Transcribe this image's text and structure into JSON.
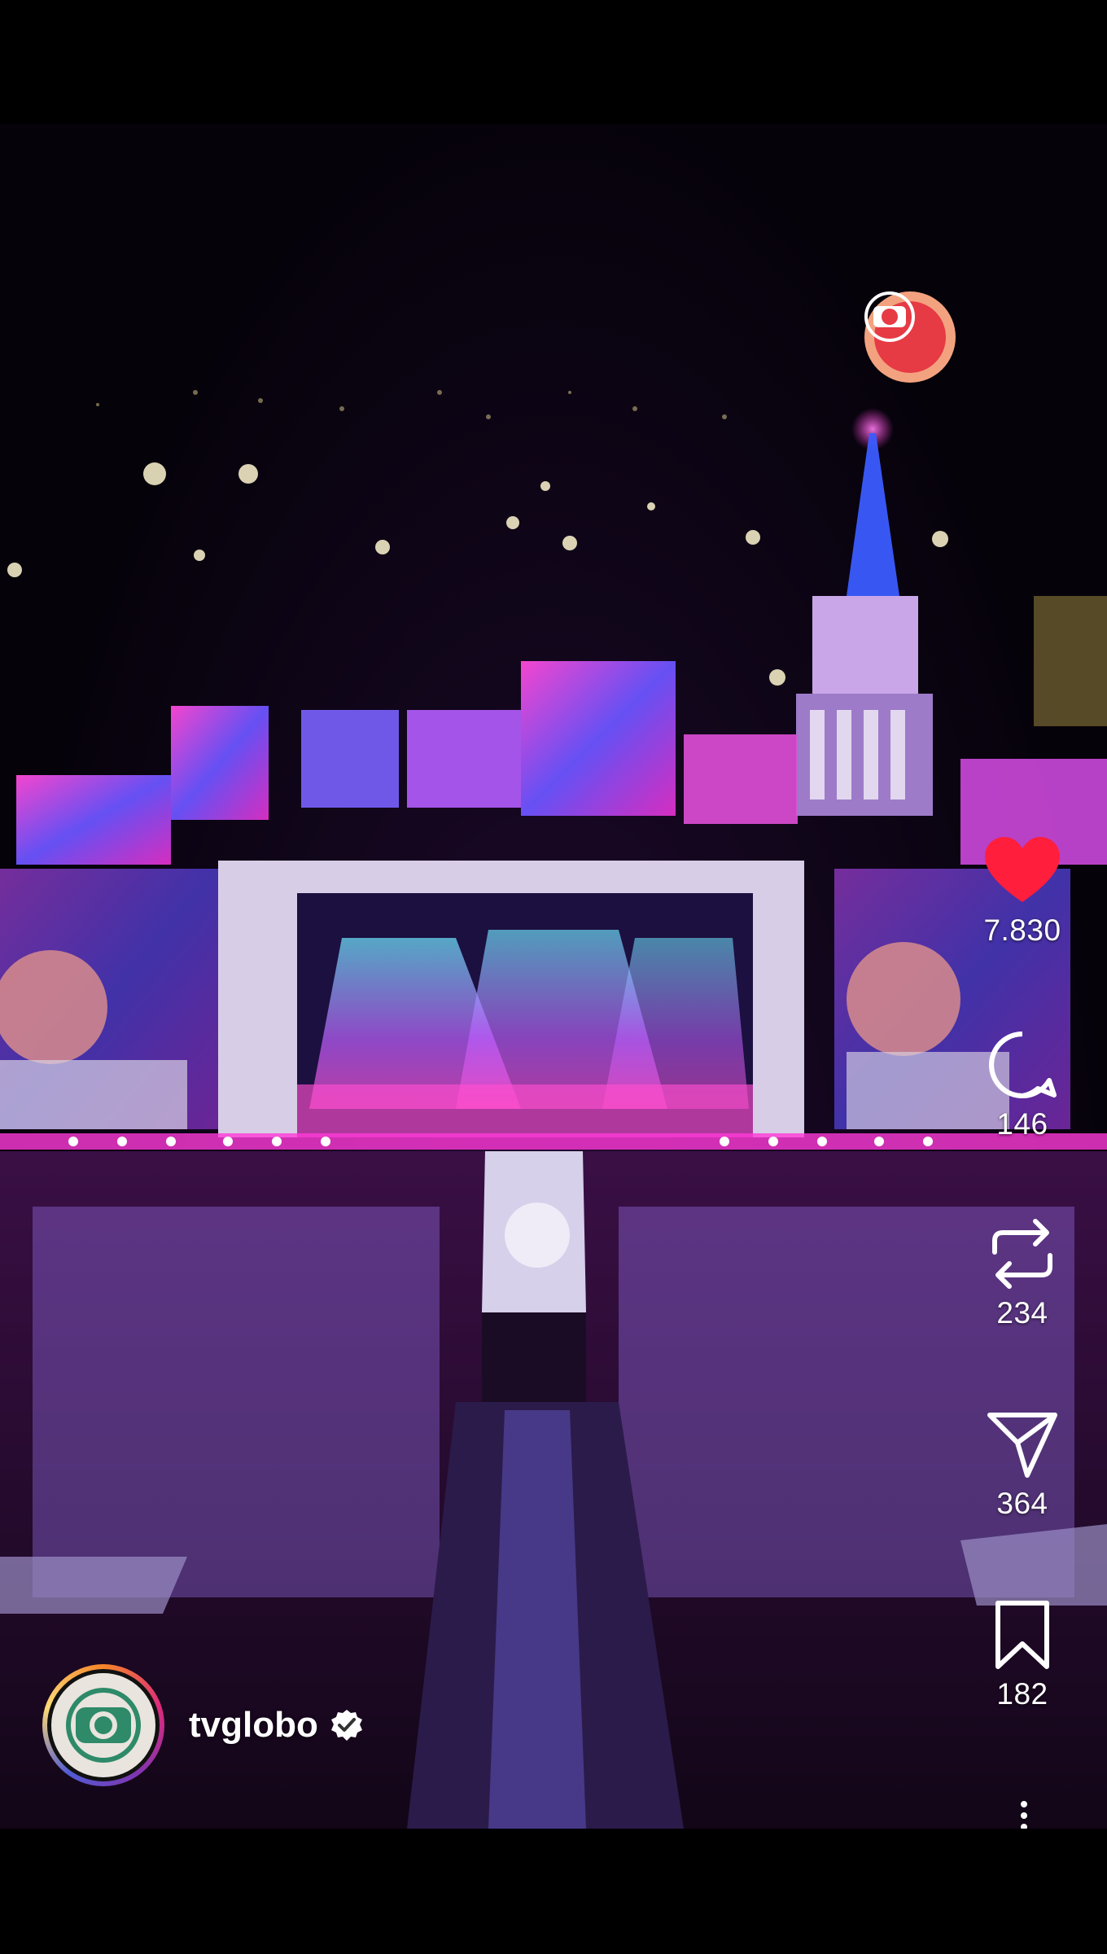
{
  "post": {
    "account": {
      "username": "tvglobo",
      "verified": true,
      "avatar_icon": "tvglobo-logo-icon"
    },
    "watermark_icon": "tvglobo-logo-icon"
  },
  "actions": [
    {
      "name": "like",
      "icon": "heart-filled-icon",
      "count": "7.830",
      "color": "#ff1e3c"
    },
    {
      "name": "comment",
      "icon": "comment-bubble-icon",
      "count": "146"
    },
    {
      "name": "repost",
      "icon": "repost-icon",
      "count": "234"
    },
    {
      "name": "share",
      "icon": "send-icon",
      "count": "364"
    },
    {
      "name": "save",
      "icon": "bookmark-icon",
      "count": "182"
    }
  ],
  "more_icon": "more-vertical-icon"
}
